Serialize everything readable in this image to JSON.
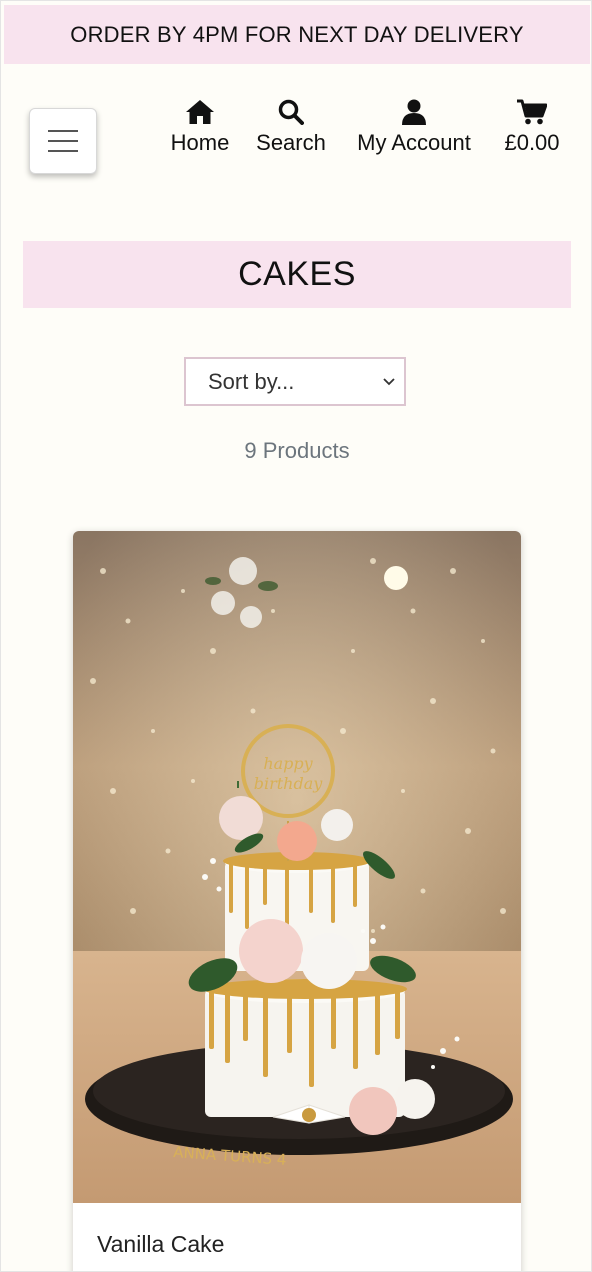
{
  "banner": {
    "text": "ORDER BY 4PM FOR NEXT DAY DELIVERY"
  },
  "nav": {
    "home_label": "Home",
    "search_label": "Search",
    "account_label": "My Account",
    "basket_total": "£0.00"
  },
  "icons": {
    "menu": "hamburger-icon",
    "home": "home-icon",
    "search": "search-icon",
    "account": "user-icon",
    "basket": "shopping-cart-icon"
  },
  "page": {
    "title": "CAKES"
  },
  "sort": {
    "selected": "Sort by..."
  },
  "products": {
    "count_label": "9 Products",
    "items": [
      {
        "name": "Vanilla Cake"
      }
    ]
  },
  "colors": {
    "accent_pink": "#f8e3ee",
    "page_background": "#fefdf8",
    "sort_border": "#dcc5d0",
    "muted_text": "#6c757d"
  }
}
